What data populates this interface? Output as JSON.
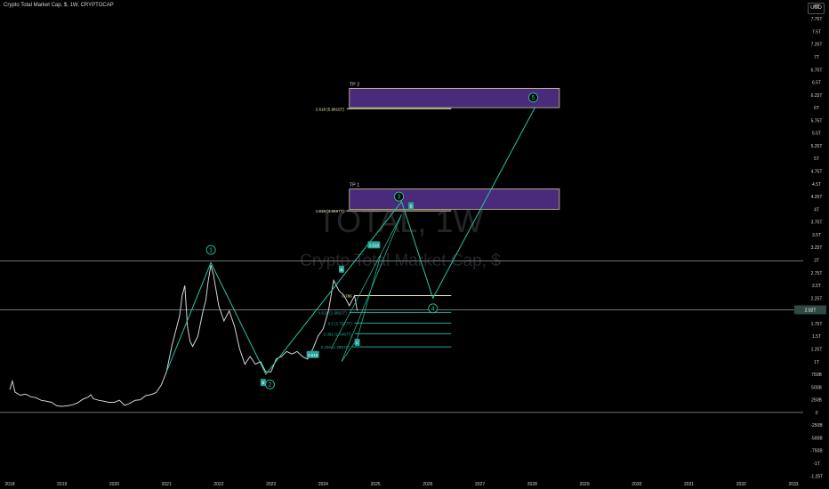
{
  "header": {
    "title": "Crypto Total Market Cap, $, 1W, CRYPTOCAP"
  },
  "currency_button": "USD",
  "watermark": {
    "symbol": "TOTAL, 1W",
    "description": "Crypto Total Market Cap, $"
  },
  "colors": {
    "background": "#000000",
    "price_line": "#d1d4dc",
    "wave": "#26c6a6",
    "target_fill": "#4a2a7a",
    "target_border": "#d4c9a0",
    "fib_yellow": "#f5f0b0",
    "fib_green": "#26a69a",
    "axis_text": "#d1d4dc"
  },
  "chart_data": {
    "type": "line",
    "title": "Crypto Total Market Cap, $, 1W, CRYPTOCAP",
    "x_axis": {
      "ticks": [
        "2018",
        "2019",
        "2020",
        "2021",
        "2022",
        "2023",
        "2024",
        "2025",
        "2026",
        "2027",
        "2028",
        "2029",
        "2030",
        "2031",
        "2032",
        "2033"
      ]
    },
    "y_axis": {
      "unit": "USD",
      "ylim": [
        -1.35,
        8.05
      ],
      "ticks": [
        {
          "v": 8.0,
          "label": "8T"
        },
        {
          "v": 7.75,
          "label": "7.75T"
        },
        {
          "v": 7.5,
          "label": "7.5T"
        },
        {
          "v": 7.25,
          "label": "7.25T"
        },
        {
          "v": 7.0,
          "label": "7T"
        },
        {
          "v": 6.75,
          "label": "6.75T"
        },
        {
          "v": 6.5,
          "label": "6.5T"
        },
        {
          "v": 6.25,
          "label": "6.25T"
        },
        {
          "v": 6.0,
          "label": "6T"
        },
        {
          "v": 5.75,
          "label": "5.75T"
        },
        {
          "v": 5.5,
          "label": "5.5T"
        },
        {
          "v": 5.25,
          "label": "5.25T"
        },
        {
          "v": 5.0,
          "label": "5T"
        },
        {
          "v": 4.75,
          "label": "4.75T"
        },
        {
          "v": 4.5,
          "label": "4.5T"
        },
        {
          "v": 4.25,
          "label": "4.25T"
        },
        {
          "v": 4.0,
          "label": "4T"
        },
        {
          "v": 3.75,
          "label": "3.75T"
        },
        {
          "v": 3.5,
          "label": "3.5T"
        },
        {
          "v": 3.25,
          "label": "3.25T"
        },
        {
          "v": 3.0,
          "label": "3T"
        },
        {
          "v": 2.75,
          "label": "2.75T"
        },
        {
          "v": 2.5,
          "label": "2.5T"
        },
        {
          "v": 2.25,
          "label": "2.25T"
        },
        {
          "v": 2.0,
          "label": "2T"
        },
        {
          "v": 1.75,
          "label": "1.75T"
        },
        {
          "v": 1.5,
          "label": "1.5T"
        },
        {
          "v": 1.25,
          "label": "1.25T"
        },
        {
          "v": 1.0,
          "label": "1T"
        },
        {
          "v": 0.75,
          "label": "750B"
        },
        {
          "v": 0.5,
          "label": "500B"
        },
        {
          "v": 0.25,
          "label": "250B"
        },
        {
          "v": 0.0,
          "label": "0"
        },
        {
          "v": -0.25,
          "label": "-250B"
        },
        {
          "v": -0.5,
          "label": "-500B"
        },
        {
          "v": -0.75,
          "label": "-750B"
        },
        {
          "v": -1.0,
          "label": "-1T"
        },
        {
          "v": -1.25,
          "label": "-1.25T"
        }
      ]
    },
    "price_series": {
      "name": "TOTAL",
      "points": [
        [
          2018.0,
          0.45
        ],
        [
          2018.05,
          0.62
        ],
        [
          2018.1,
          0.4
        ],
        [
          2018.2,
          0.34
        ],
        [
          2018.3,
          0.36
        ],
        [
          2018.4,
          0.31
        ],
        [
          2018.5,
          0.29
        ],
        [
          2018.6,
          0.24
        ],
        [
          2018.7,
          0.22
        ],
        [
          2018.8,
          0.2
        ],
        [
          2018.9,
          0.13
        ],
        [
          2019.0,
          0.12
        ],
        [
          2019.1,
          0.13
        ],
        [
          2019.2,
          0.15
        ],
        [
          2019.3,
          0.19
        ],
        [
          2019.4,
          0.26
        ],
        [
          2019.5,
          0.3
        ],
        [
          2019.55,
          0.35
        ],
        [
          2019.6,
          0.27
        ],
        [
          2019.7,
          0.24
        ],
        [
          2019.8,
          0.22
        ],
        [
          2019.9,
          0.2
        ],
        [
          2020.0,
          0.2
        ],
        [
          2020.1,
          0.24
        ],
        [
          2020.2,
          0.14
        ],
        [
          2020.3,
          0.18
        ],
        [
          2020.4,
          0.24
        ],
        [
          2020.5,
          0.25
        ],
        [
          2020.6,
          0.33
        ],
        [
          2020.7,
          0.35
        ],
        [
          2020.8,
          0.39
        ],
        [
          2020.9,
          0.54
        ],
        [
          2021.0,
          0.8
        ],
        [
          2021.1,
          1.3
        ],
        [
          2021.15,
          1.5
        ],
        [
          2021.25,
          1.9
        ],
        [
          2021.3,
          2.3
        ],
        [
          2021.35,
          2.5
        ],
        [
          2021.4,
          1.7
        ],
        [
          2021.45,
          1.4
        ],
        [
          2021.5,
          1.3
        ],
        [
          2021.6,
          1.5
        ],
        [
          2021.7,
          2.0
        ],
        [
          2021.75,
          2.2
        ],
        [
          2021.8,
          2.6
        ],
        [
          2021.85,
          2.9
        ],
        [
          2021.9,
          2.7
        ],
        [
          2022.0,
          2.1
        ],
        [
          2022.1,
          1.8
        ],
        [
          2022.2,
          2.0
        ],
        [
          2022.3,
          1.7
        ],
        [
          2022.4,
          1.25
        ],
        [
          2022.5,
          0.95
        ],
        [
          2022.6,
          1.1
        ],
        [
          2022.7,
          0.95
        ],
        [
          2022.8,
          1.0
        ],
        [
          2022.9,
          0.8
        ],
        [
          2023.0,
          0.8
        ],
        [
          2023.1,
          1.05
        ],
        [
          2023.2,
          1.1
        ],
        [
          2023.3,
          1.2
        ],
        [
          2023.4,
          1.15
        ],
        [
          2023.5,
          1.2
        ],
        [
          2023.6,
          1.1
        ],
        [
          2023.7,
          1.05
        ],
        [
          2023.8,
          1.25
        ],
        [
          2023.9,
          1.5
        ],
        [
          2024.0,
          1.65
        ],
        [
          2024.1,
          2.0
        ],
        [
          2024.2,
          2.6
        ],
        [
          2024.3,
          2.4
        ],
        [
          2024.4,
          2.3
        ],
        [
          2024.5,
          2.1
        ],
        [
          2024.6,
          2.3
        ],
        [
          2024.65,
          2.0
        ]
      ]
    },
    "wave_labels": [
      {
        "label": "1",
        "x": 2021.85,
        "y": 3.2
      },
      {
        "label": "2",
        "x": 2022.98,
        "y": 0.55
      },
      {
        "label": "3",
        "x": 2025.45,
        "y": 4.25
      },
      {
        "label": "4",
        "x": 2026.1,
        "y": 2.05
      },
      {
        "label": "5",
        "x": 2028.02,
        "y": 6.2
      }
    ],
    "wave_path": [
      [
        2021.0,
        0.8
      ],
      [
        2021.85,
        2.95
      ],
      [
        2022.9,
        0.75
      ],
      [
        2025.5,
        4.15
      ],
      [
        2026.1,
        2.25
      ],
      [
        2028.05,
        6.0
      ]
    ],
    "projection_path": [
      [
        2024.15,
        1.25
      ],
      [
        2025.5,
        3.9
      ],
      [
        2024.35,
        1.0
      ],
      [
        2024.65,
        1.45
      ],
      [
        2025.1,
        3.1
      ]
    ],
    "target_zones": [
      {
        "label": "TP 2",
        "x_from": 2024.5,
        "x_to": 2028.52,
        "y_from": 6.0,
        "y_to": 6.38
      },
      {
        "label": "TP 1",
        "x_from": 2024.5,
        "x_to": 2028.52,
        "y_from": 4.0,
        "y_to": 4.4
      }
    ],
    "fib_levels": [
      {
        "label": "2.618 (5.9815T)",
        "value": 5.98,
        "x_from": 2024.45,
        "x_to": 2026.45,
        "color": "yellow"
      },
      {
        "label": "1.618 (3.9697T)",
        "value": 3.97,
        "x_from": 2024.45,
        "x_to": 2026.45,
        "color": "yellow"
      },
      {
        "label": "0.786",
        "value": 2.3,
        "x_from": 2024.6,
        "x_to": 2026.45,
        "color": "yellow"
      },
      {
        "label": "0.618 (1.9661T)",
        "value": 1.97,
        "x_from": 2024.5,
        "x_to": 2026.45,
        "color": "green"
      },
      {
        "label": "0.5 (1.7577T)",
        "value": 1.76,
        "x_from": 2024.6,
        "x_to": 2026.45,
        "color": "green"
      },
      {
        "label": "0.382 (1.5487T)",
        "value": 1.55,
        "x_from": 2024.6,
        "x_to": 2026.45,
        "color": "green"
      },
      {
        "label": "0.236 (1.2851T)",
        "value": 1.29,
        "x_from": 2024.55,
        "x_to": 2026.45,
        "color": "green"
      }
    ],
    "horizontal_lines": [
      2.98,
      2.02,
      0.0
    ],
    "badges": [
      {
        "text": "1.618",
        "x": 2024.97,
        "y": 3.3
      },
      {
        "text": "0.618",
        "x": 2023.8,
        "y": 1.14
      },
      {
        "text": "B",
        "x": 2024.35,
        "y": 2.82
      },
      {
        "text": "C",
        "x": 2024.65,
        "y": 1.38
      },
      {
        "text": "B",
        "x": 2025.68,
        "y": 4.07
      },
      {
        "text": "B",
        "x": 2022.85,
        "y": 0.59
      }
    ],
    "current_price": {
      "value": 2.02,
      "label": "2.02T"
    }
  }
}
